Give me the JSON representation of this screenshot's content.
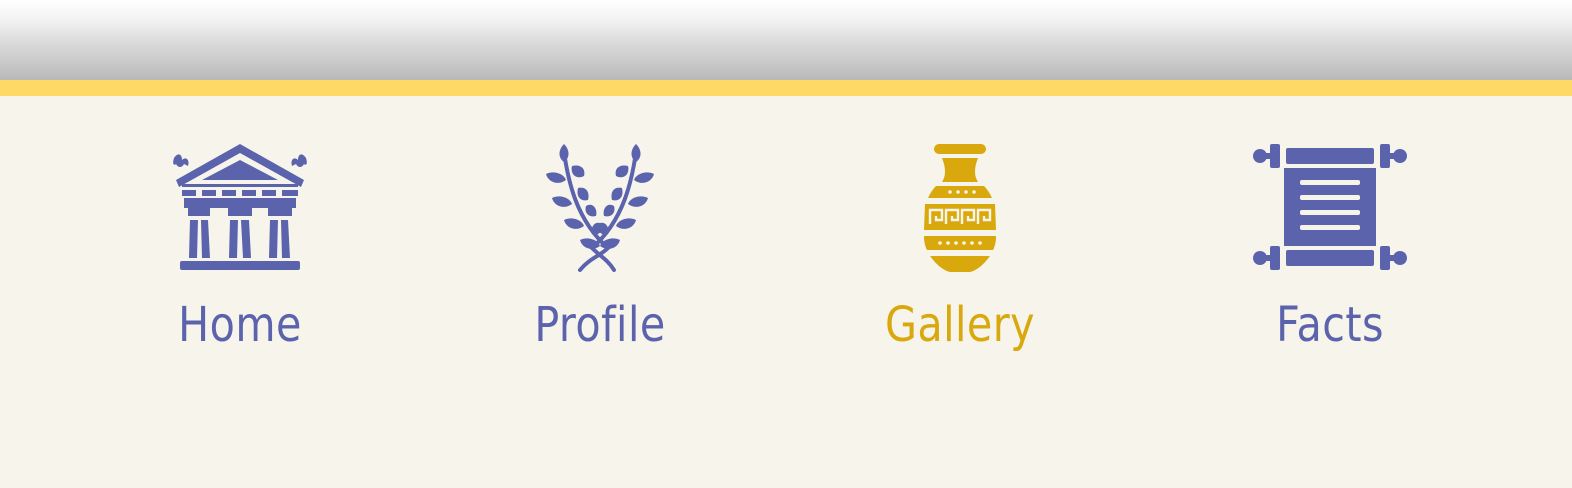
{
  "colors": {
    "inactive": "#5b63ad",
    "active": "#d8a80c",
    "accent_bar": "#ffd966",
    "background": "#f7f4ec"
  },
  "nav": {
    "active_item": "gallery",
    "items": [
      {
        "id": "home",
        "label": "Home",
        "icon": "temple-icon"
      },
      {
        "id": "profile",
        "label": "Profile",
        "icon": "laurel-wreath-icon"
      },
      {
        "id": "gallery",
        "label": "Gallery",
        "icon": "amphora-vase-icon"
      },
      {
        "id": "facts",
        "label": "Facts",
        "icon": "scroll-icon"
      }
    ]
  }
}
